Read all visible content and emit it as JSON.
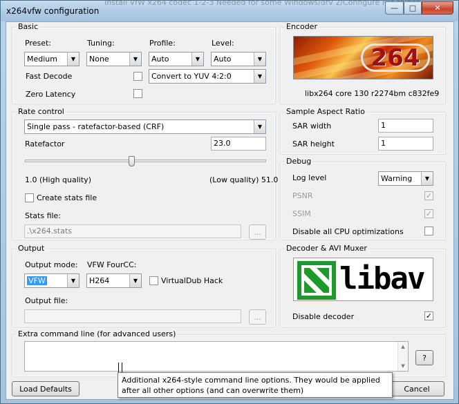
{
  "window": {
    "title": "x264vfw configuration",
    "background_title": "Install VfW x264 codec 1-2-3      Needed for some Windows/drv 2/Configure      File folder",
    "controls": {
      "minimize": "—",
      "maximize": "□",
      "close": "✕"
    }
  },
  "basic": {
    "title": "Basic",
    "preset_label": "Preset:",
    "preset_value": "Medium",
    "tuning_label": "Tuning:",
    "tuning_value": "None",
    "profile_label": "Profile:",
    "profile_value": "Auto",
    "level_label": "Level:",
    "level_value": "Auto",
    "fast_decode_label": "Fast Decode",
    "fast_decode_checked": false,
    "colorspace_value": "Convert to YUV 4:2:0",
    "zero_latency_label": "Zero Latency",
    "zero_latency_checked": false
  },
  "encoder": {
    "title": "Encoder",
    "logo_text": "264",
    "version": "libx264 core 130 r2274bm c832fe9"
  },
  "rate_control": {
    "title": "Rate control",
    "mode_value": "Single pass - ratefactor-based (CRF)",
    "ratefactor_label": "Ratefactor",
    "ratefactor_value": "23.0",
    "slider_value_fraction": 0.44,
    "min_label": "1.0 (High quality)",
    "max_label": "(Low quality) 51.0",
    "create_stats_label": "Create stats file",
    "create_stats_checked": false,
    "stats_file_label": "Stats file:",
    "stats_file_value": ".\\x264.stats",
    "browse_label": "..."
  },
  "sar": {
    "title": "Sample Aspect Ratio",
    "width_label": "SAR width",
    "width_value": "1",
    "height_label": "SAR height",
    "height_value": "1"
  },
  "debug": {
    "title": "Debug",
    "log_level_label": "Log level",
    "log_level_value": "Warning",
    "psnr_label": "PSNR",
    "psnr_checked": true,
    "ssim_label": "SSIM",
    "ssim_checked": true,
    "disable_cpu_label": "Disable all CPU optimizations",
    "disable_cpu_checked": false
  },
  "output": {
    "title": "Output",
    "mode_label": "Output mode:",
    "mode_value": "VFW",
    "fourcc_label": "VFW FourCC:",
    "fourcc_value": "H264",
    "vdub_hack_label": "VirtualDub Hack",
    "vdub_hack_checked": false,
    "file_label": "Output file:",
    "file_value": "",
    "browse_label": "..."
  },
  "decoder": {
    "title": "Decoder & AVI Muxer",
    "logo_text": "libav",
    "disable_decoder_label": "Disable decoder",
    "disable_decoder_checked": true
  },
  "extra": {
    "title": "Extra command line (for advanced users)",
    "value": "",
    "help_label": "?"
  },
  "tooltip": {
    "text": "Additional x264-style command line options. They would be applied after all other options (and can overwrite them)"
  },
  "buttons": {
    "load_defaults": "Load Defaults",
    "cancel": "Cancel"
  },
  "colors": {
    "selection": "#3399ff",
    "window_frame": "#a5c4de",
    "dialog_bg": "#f0f0f0"
  }
}
